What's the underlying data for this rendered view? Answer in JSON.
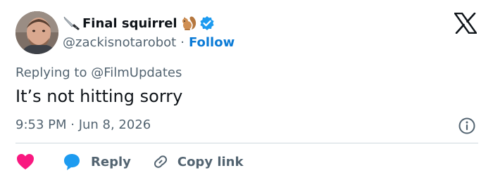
{
  "author": {
    "display_name": "Final squirrel",
    "handle": "@zackisnotarobot",
    "separator": "·",
    "follow_label": "Follow"
  },
  "tweet": {
    "reply_prefix": "Replying to ",
    "reply_to": "@FilmUpdates",
    "text": "It’s not hitting sorry",
    "timestamp": "9:53 PM · Jun 8, 2026"
  },
  "actions": {
    "reply_label": "Reply",
    "copy_label": "Copy link"
  },
  "icons": {
    "brand": "x-logo-icon",
    "knife": "knife-emoji-icon",
    "squirrel": "squirrel-emoji-icon",
    "verified": "verified-badge-icon",
    "info": "info-icon",
    "like": "heart-icon",
    "reply": "speech-bubble-icon",
    "copy": "link-icon"
  },
  "colors": {
    "text": "#0f1419",
    "secondary": "#536471",
    "accent": "#1d9bf0",
    "follow": "#0c7bd6",
    "like": "#f91880",
    "divider": "#cfd9de"
  }
}
